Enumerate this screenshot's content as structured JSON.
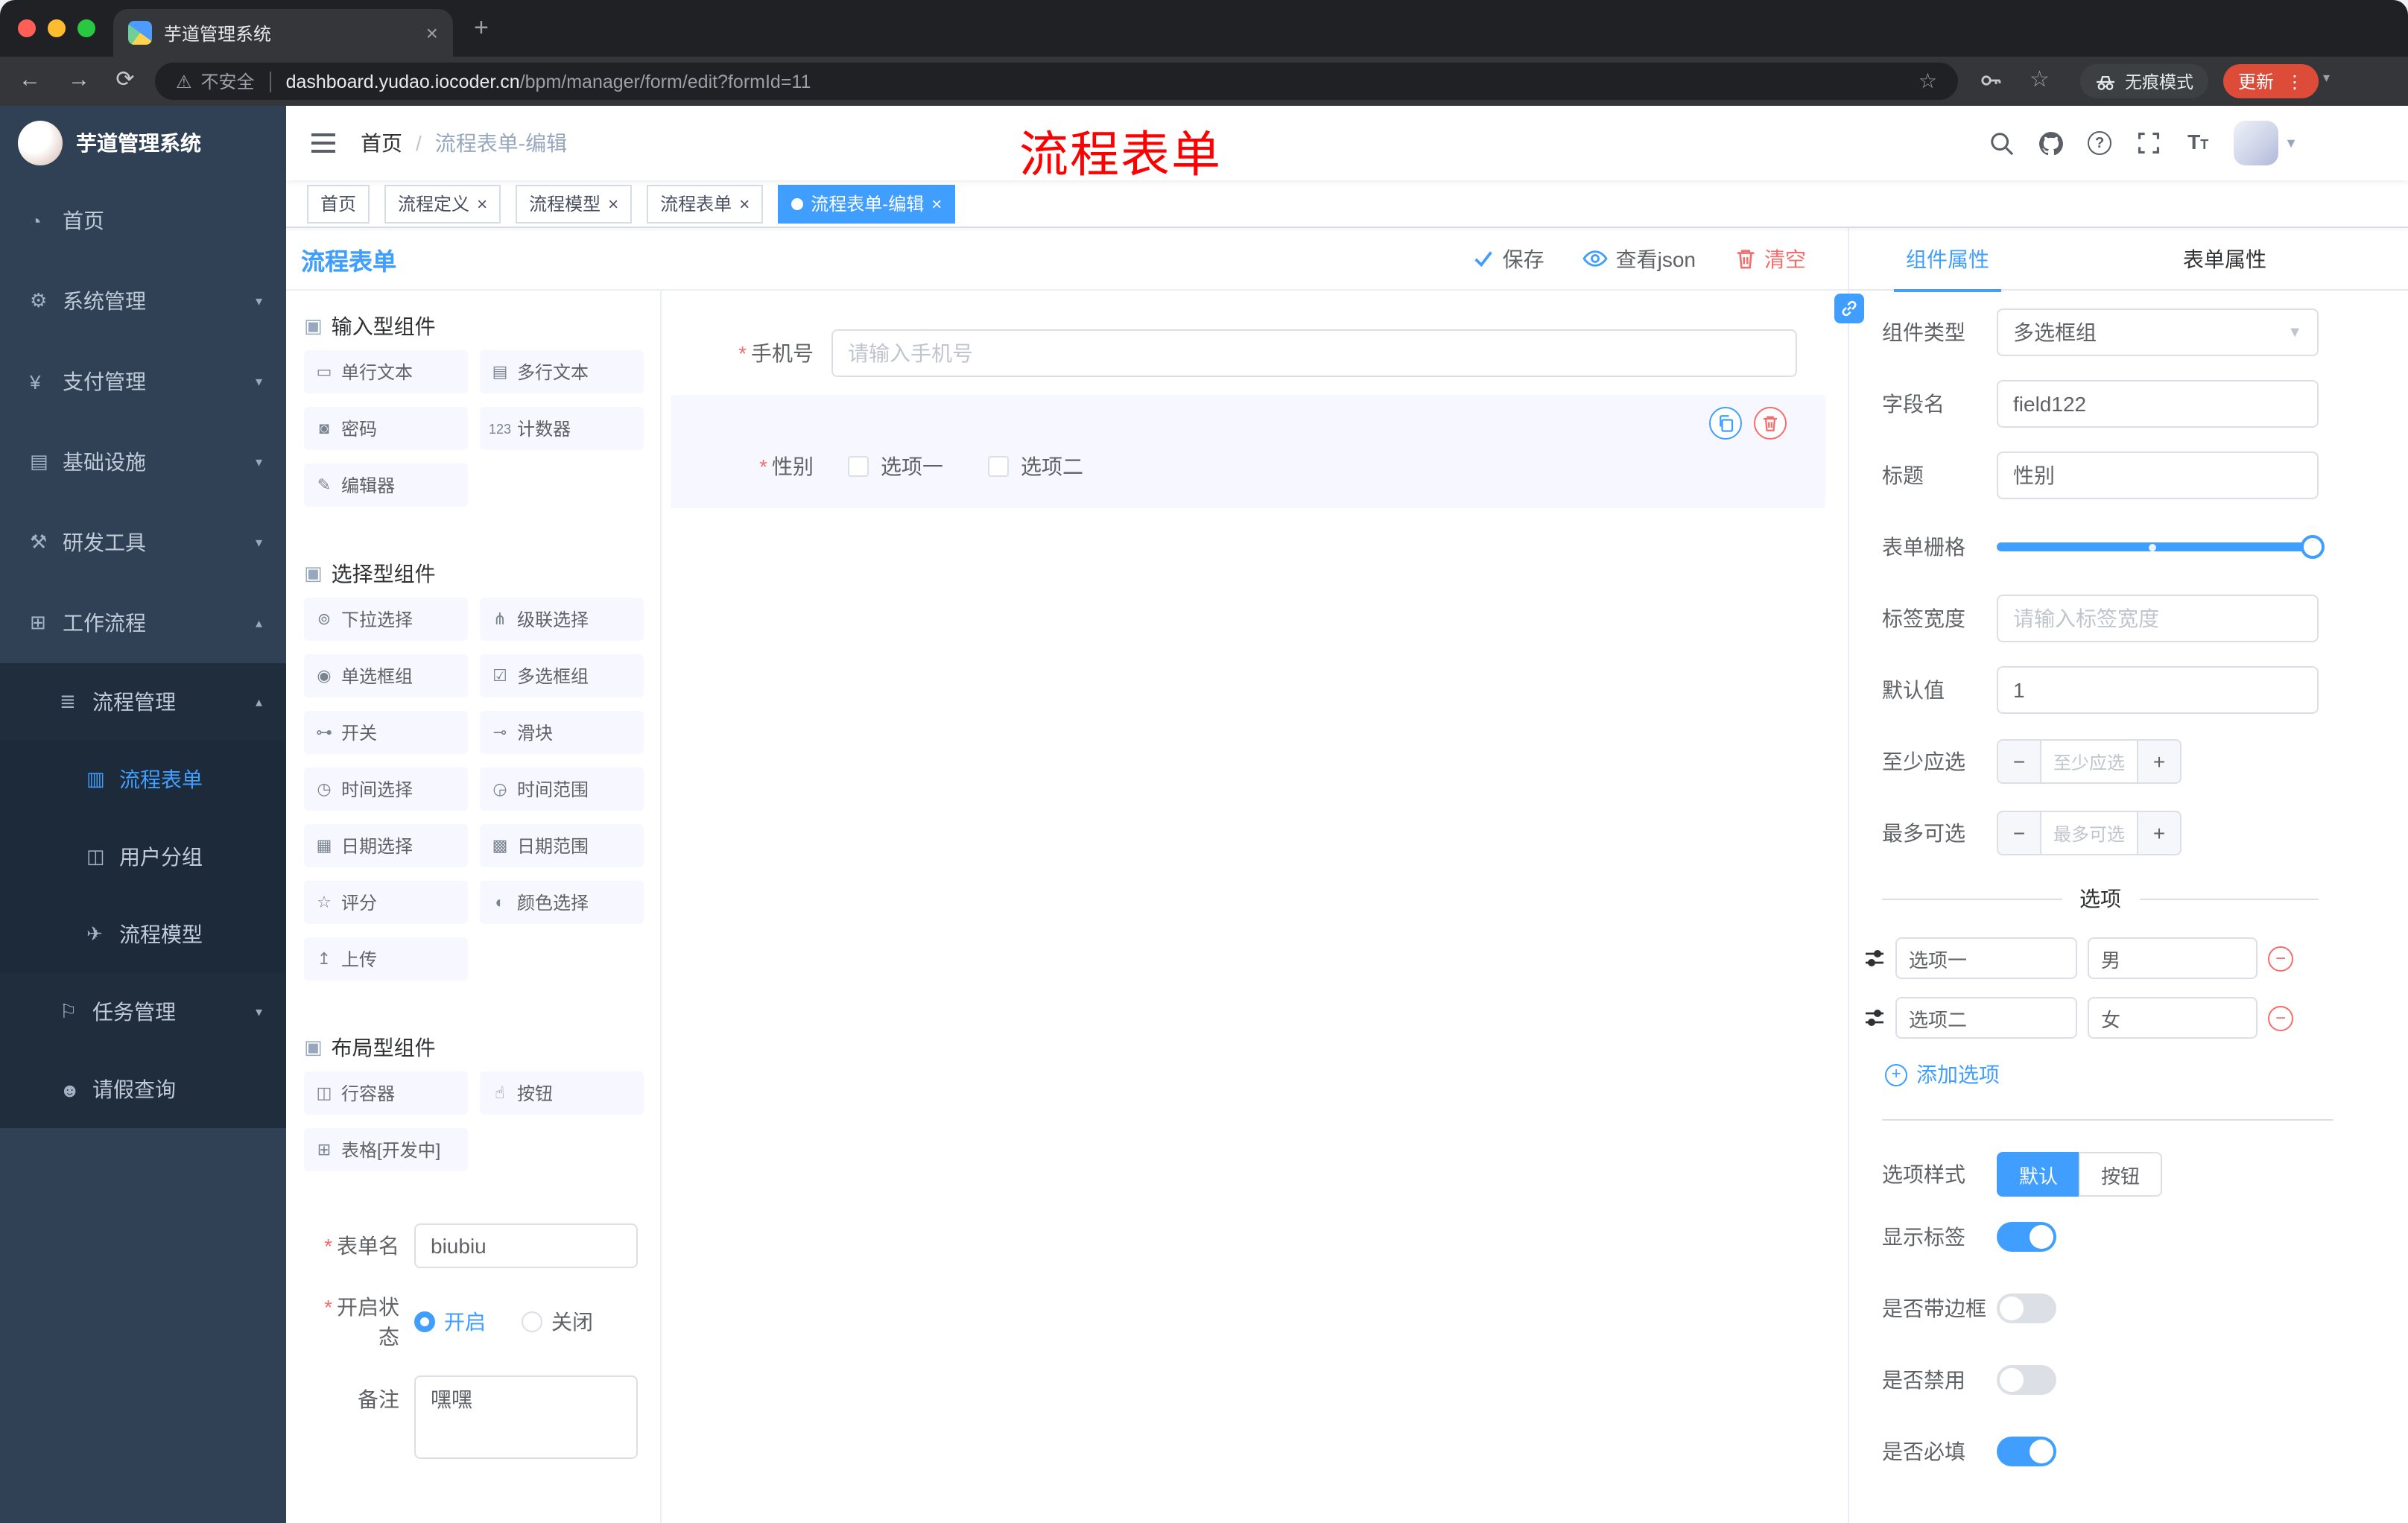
{
  "chrome": {
    "tab_title": "芋道管理系统",
    "security_label": "不安全",
    "url_domain": "dashboard.yudao.iocoder.cn",
    "url_path": "/bpm/manager/form/edit?formId=11",
    "incognito_label": "无痕模式",
    "update_label": "更新"
  },
  "sidebar": {
    "logo_title": "芋道管理系统",
    "menu": [
      {
        "id": "home",
        "label": "首页",
        "icon": "dashboard-icon",
        "glyph": "◔",
        "level": 1
      },
      {
        "id": "system",
        "label": "系统管理",
        "icon": "gear-icon",
        "glyph": "⚙",
        "level": 1,
        "arrow": "down"
      },
      {
        "id": "payment",
        "label": "支付管理",
        "icon": "yen-icon",
        "glyph": "¥",
        "level": 1,
        "arrow": "down"
      },
      {
        "id": "infrastructure",
        "label": "基础设施",
        "icon": "infrastructure-icon",
        "glyph": "▤",
        "level": 1,
        "arrow": "down"
      },
      {
        "id": "devtools",
        "label": "研发工具",
        "icon": "tools-icon",
        "glyph": "⚒",
        "level": 1,
        "arrow": "down"
      },
      {
        "id": "workflow",
        "label": "工作流程",
        "icon": "workflow-icon",
        "glyph": "⊞",
        "level": 1,
        "arrow": "up"
      },
      {
        "id": "process-management",
        "label": "流程管理",
        "icon": "process-list-icon",
        "glyph": "≣",
        "level": 2,
        "arrow": "up"
      },
      {
        "id": "process-form",
        "label": "流程表单",
        "icon": "form-document-icon",
        "glyph": "▥",
        "level": 3,
        "active": true
      },
      {
        "id": "user-group",
        "label": "用户分组",
        "icon": "user-group-icon",
        "glyph": "◫",
        "level": 3
      },
      {
        "id": "process-model",
        "label": "流程模型",
        "icon": "paper-plane-icon",
        "glyph": "✈",
        "level": 3
      },
      {
        "id": "task-management",
        "label": "任务管理",
        "icon": "task-flag-icon",
        "glyph": "⚐",
        "level": 2,
        "arrow": "down"
      },
      {
        "id": "leave-query",
        "label": "请假查询",
        "icon": "person-icon",
        "glyph": "☻",
        "level": 2
      }
    ]
  },
  "navbar": {
    "breadcrumb": {
      "home": "首页",
      "separator": "/",
      "current": "流程表单-编辑"
    },
    "overlay_title": "流程表单"
  },
  "tags": [
    {
      "id": "home",
      "label": "首页"
    },
    {
      "id": "process-definition",
      "label": "流程定义",
      "closable": true
    },
    {
      "id": "process-model",
      "label": "流程模型",
      "closable": true
    },
    {
      "id": "process-form",
      "label": "流程表单",
      "closable": true
    },
    {
      "id": "process-form-edit",
      "label": "流程表单-编辑",
      "closable": true,
      "active": true
    }
  ],
  "designer": {
    "title": "流程表单",
    "actions": {
      "save": "保存",
      "view_json": "查看json",
      "clear": "清空"
    }
  },
  "palette": {
    "groups": [
      {
        "title": "输入型组件",
        "items": [
          {
            "id": "single-line-text",
            "label": "单行文本",
            "icon": "single-line-text-icon",
            "glyph": "▭"
          },
          {
            "id": "multi-line-text",
            "label": "多行文本",
            "icon": "multi-line-text-icon",
            "glyph": "▤"
          },
          {
            "id": "password",
            "label": "密码",
            "icon": "lock-icon",
            "glyph": "◙"
          },
          {
            "id": "counter",
            "label": "计数器",
            "icon": "counter-icon",
            "glyph": "123"
          },
          {
            "id": "editor",
            "label": "编辑器",
            "icon": "editor-icon",
            "glyph": "✎"
          }
        ]
      },
      {
        "title": "选择型组件",
        "items": [
          {
            "id": "select",
            "label": "下拉选择",
            "icon": "select-icon",
            "glyph": "⊚"
          },
          {
            "id": "cascader",
            "label": "级联选择",
            "icon": "cascader-icon",
            "glyph": "⋔"
          },
          {
            "id": "radio-group",
            "label": "单选框组",
            "icon": "radio-icon",
            "glyph": "◉"
          },
          {
            "id": "checkbox-group",
            "label": "多选框组",
            "icon": "checkbox-icon",
            "glyph": "☑"
          },
          {
            "id": "switch",
            "label": "开关",
            "icon": "switch-icon",
            "glyph": "⊶"
          },
          {
            "id": "slider",
            "label": "滑块",
            "icon": "slider-icon",
            "glyph": "⊸"
          },
          {
            "id": "time-picker",
            "label": "时间选择",
            "icon": "clock-icon",
            "glyph": "◷"
          },
          {
            "id": "time-range",
            "label": "时间范围",
            "icon": "clock-range-icon",
            "glyph": "◶"
          },
          {
            "id": "date-picker",
            "label": "日期选择",
            "icon": "calendar-icon",
            "glyph": "▦"
          },
          {
            "id": "date-range",
            "label": "日期范围",
            "icon": "calendar-range-icon",
            "glyph": "▩"
          },
          {
            "id": "rate",
            "label": "评分",
            "icon": "star-icon",
            "glyph": "☆"
          },
          {
            "id": "color-picker",
            "label": "颜色选择",
            "icon": "color-icon",
            "glyph": "◐"
          },
          {
            "id": "upload",
            "label": "上传",
            "icon": "upload-icon",
            "glyph": "↥"
          }
        ]
      },
      {
        "title": "布局型组件",
        "items": [
          {
            "id": "row-container",
            "label": "行容器",
            "icon": "row-container-icon",
            "glyph": "◫"
          },
          {
            "id": "button",
            "label": "按钮",
            "icon": "pointer-icon",
            "glyph": "☝"
          },
          {
            "id": "table",
            "label": "表格[开发中]",
            "icon": "table-icon",
            "glyph": "⊞"
          }
        ]
      }
    ]
  },
  "form_meta": {
    "name": {
      "label": "表单名",
      "value": "biubiu",
      "required": true
    },
    "status": {
      "label": "开启状态",
      "required": true,
      "options": [
        {
          "label": "开启",
          "selected": true
        },
        {
          "label": "关闭",
          "selected": false
        }
      ]
    },
    "remark": {
      "label": "备注",
      "value": "嘿嘿"
    }
  },
  "canvas": {
    "phone_field": {
      "label": "手机号",
      "required": true,
      "placeholder": "请输入手机号"
    },
    "gender_field": {
      "label": "性别",
      "required": true,
      "options": [
        {
          "label": "选项一",
          "checked": false
        },
        {
          "label": "选项二",
          "checked": false
        }
      ]
    }
  },
  "properties": {
    "tabs": {
      "component": "组件属性",
      "form": "表单属性",
      "active": "组件属性"
    },
    "component_type": {
      "label": "组件类型",
      "value": "多选框组"
    },
    "field_name": {
      "label": "字段名",
      "value": "field122"
    },
    "title": {
      "label": "标题",
      "value": "性别"
    },
    "grid": {
      "label": "表单栅格"
    },
    "label_width": {
      "label": "标签宽度",
      "placeholder": "请输入标签宽度"
    },
    "default_value": {
      "label": "默认值",
      "value": "1"
    },
    "min_select": {
      "label": "至少应选",
      "placeholder": "至少应选",
      "minus": "−",
      "plus": "+"
    },
    "max_select": {
      "label": "最多可选",
      "placeholder": "最多可选",
      "minus": "−",
      "plus": "+"
    },
    "options_divider": "选项",
    "options": [
      {
        "label": "选项一",
        "value": "男"
      },
      {
        "label": "选项二",
        "value": "女"
      }
    ],
    "add_option": "添加选项",
    "option_style": {
      "label": "选项样式",
      "choices": [
        {
          "label": "默认",
          "active": true
        },
        {
          "label": "按钮",
          "active": false
        }
      ]
    },
    "toggles": [
      {
        "id": "show-label",
        "label": "显示标签",
        "on": true
      },
      {
        "id": "bordered",
        "label": "是否带边框",
        "on": false
      },
      {
        "id": "disabled",
        "label": "是否禁用",
        "on": false
      },
      {
        "id": "required",
        "label": "是否必填",
        "on": true
      }
    ],
    "colors": {
      "accent": "#409eff",
      "danger": "#f56c6c"
    }
  }
}
